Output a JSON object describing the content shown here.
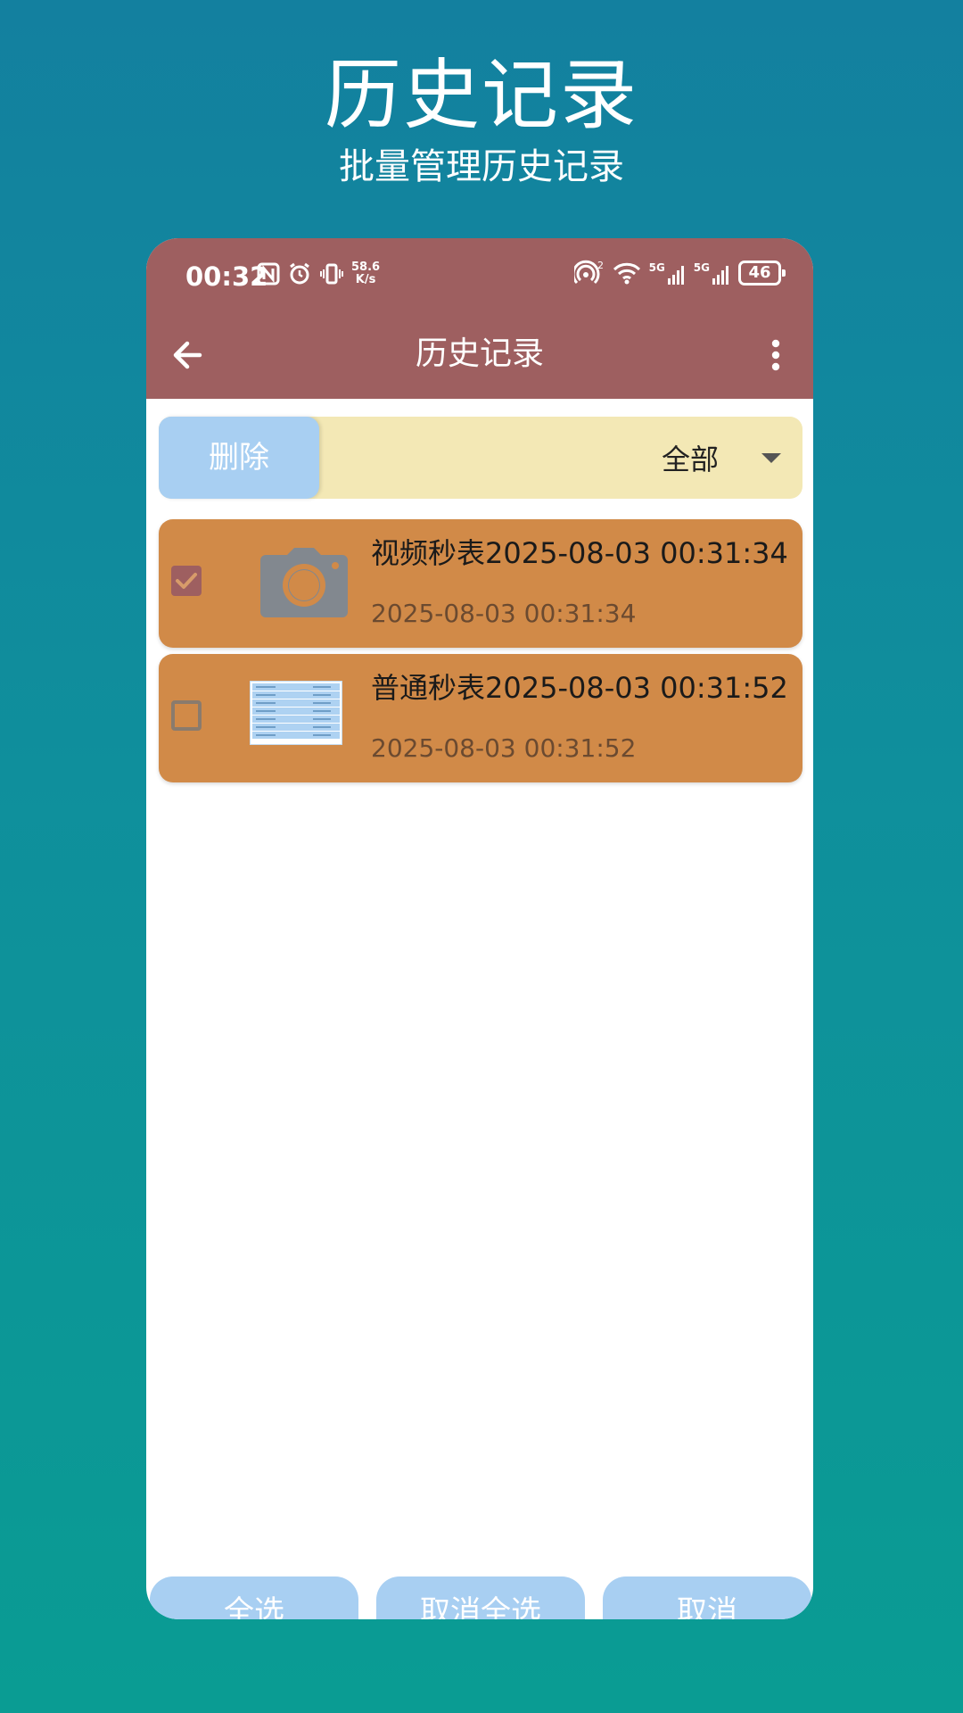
{
  "hero": {
    "title": "历史记录",
    "subtitle": "批量管理历史记录"
  },
  "status_bar": {
    "time": "00:32",
    "speed_value": "58.6",
    "speed_unit": "K/s",
    "hotspot_count": "2",
    "network_1": "5G",
    "network_2": "5G",
    "battery": "46"
  },
  "toolbar": {
    "title": "历史记录",
    "back_icon": "arrow-left-icon",
    "more_icon": "more-vertical-icon"
  },
  "filter": {
    "delete_label": "删除",
    "selected_value": "全部"
  },
  "records": [
    {
      "title": "视频秒表2025-08-03 00:31:34",
      "time": "2025-08-03 00:31:34",
      "checked": true,
      "thumbnail": "camera-icon"
    },
    {
      "title": "普通秒表2025-08-03 00:31:52",
      "time": "2025-08-03 00:31:52",
      "checked": false,
      "thumbnail": "table-thumbnail"
    }
  ],
  "bottom_actions": {
    "select_all": "全选",
    "deselect_all": "取消全选",
    "cancel": "取消"
  },
  "colors": {
    "background_top": "#13809f",
    "background_bottom": "#0a9c93",
    "appbar": "#9e5f60",
    "filter_bar": "#f3e8b5",
    "button": "#a8cff2",
    "record_item": "#d18a48"
  }
}
